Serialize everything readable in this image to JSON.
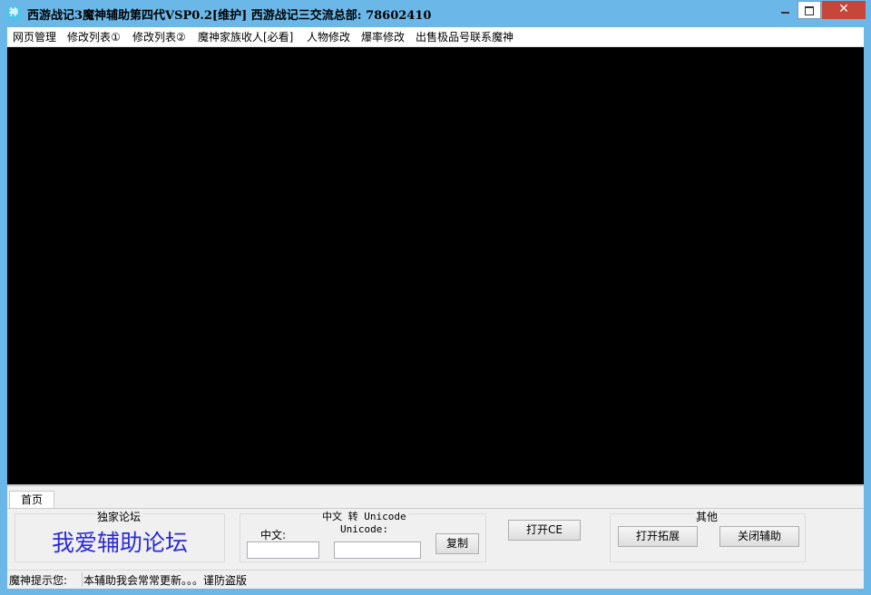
{
  "window": {
    "icon_glyph": "神",
    "title": "西游战记3魔神辅助第四代VSP0.2[维护] 西游战记三交流总部:  78602410",
    "close_glyph": "✕"
  },
  "menu": {
    "items": [
      "网页管理",
      "修改列表①",
      "修改列表②",
      "魔神家族收人[必看]",
      "人物修改",
      "爆率修改",
      "出售极品号联系魔神"
    ]
  },
  "tabs": [
    "首页"
  ],
  "forum_group": {
    "title": "独家论坛",
    "banner": "我爱辅助论坛"
  },
  "convert_group": {
    "title": "中文 转 Unicode",
    "chinese_label": "中文:",
    "unicode_label": "Unicode:",
    "chinese_value": "",
    "unicode_value": "",
    "copy_button": "复制"
  },
  "open_ce_button": "打开CE",
  "other_group": {
    "title": "其他",
    "open_ext_button": "打开拓展",
    "close_helper_button": "关闭辅助"
  },
  "status": {
    "label": "魔神提示您:",
    "message": "本辅助我会常常更新。。。谨防盗版"
  }
}
